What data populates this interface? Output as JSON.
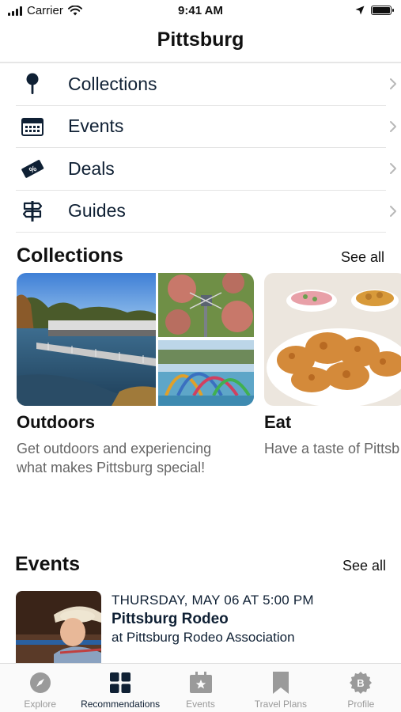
{
  "status_bar": {
    "carrier": "Carrier",
    "time": "9:41 AM"
  },
  "nav": {
    "title": "Pittsburg"
  },
  "menu": [
    {
      "label": "Collections",
      "icon": "map-pin-icon"
    },
    {
      "label": "Events",
      "icon": "calendar-icon"
    },
    {
      "label": "Deals",
      "icon": "ticket-icon"
    },
    {
      "label": "Guides",
      "icon": "signpost-icon"
    }
  ],
  "collections": {
    "title": "Collections",
    "see_all": "See all",
    "cards": [
      {
        "title": "Outdoors",
        "description_line1": "Get outdoors and experiencing",
        "description_line2": "what makes Pittsburg special!"
      },
      {
        "title": "Eat",
        "description_line1": "Have a taste of Pittsb"
      }
    ]
  },
  "events": {
    "title": "Events",
    "see_all": "See all",
    "items": [
      {
        "date": "THURSDAY, MAY 06 AT 5:00 PM",
        "name": "Pittsburg Rodeo",
        "venue": "at Pittsburg Rodeo Association"
      }
    ]
  },
  "tabs": [
    {
      "label": "Explore",
      "icon": "compass-icon",
      "active": false
    },
    {
      "label": "Recommendations",
      "icon": "grid-icon",
      "active": true
    },
    {
      "label": "Events",
      "icon": "calendar-star-icon",
      "active": false
    },
    {
      "label": "Travel Plans",
      "icon": "bookmark-icon",
      "active": false
    },
    {
      "label": "Profile",
      "icon": "profile-badge-icon",
      "active": false
    }
  ],
  "colors": {
    "navy": "#0f2034",
    "inactive_tab": "#9a9a9a",
    "divider": "#e4e4e4"
  }
}
